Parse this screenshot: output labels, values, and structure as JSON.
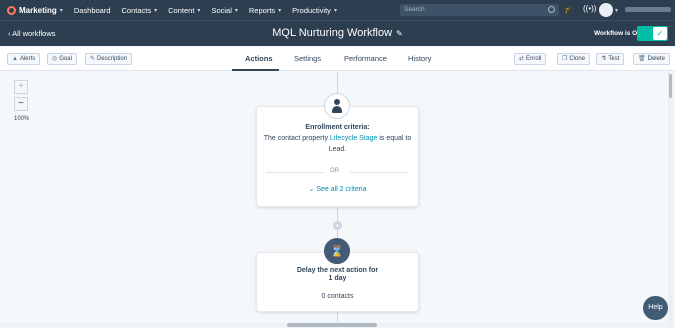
{
  "colors": {
    "nav_bg": "#2d3e50",
    "accent": "#ff7a59",
    "teal": "#00bda5",
    "link": "#0091ae"
  },
  "topnav": {
    "brand": "Marketing",
    "items": [
      "Dashboard",
      "Contacts",
      "Content",
      "Social",
      "Reports",
      "Productivity"
    ],
    "search_placeholder": "Search"
  },
  "header": {
    "back_label": "All workflows",
    "title": "MQL Nurturing Workflow",
    "status_label": "Workflow is ON",
    "toggle_check": "✓"
  },
  "toolbar": {
    "left_buttons": [
      {
        "label": "Alerts",
        "icon": "alert-icon"
      },
      {
        "label": "Goal",
        "icon": "goal-icon"
      },
      {
        "label": "Description",
        "icon": "description-icon"
      }
    ],
    "tabs": [
      "Actions",
      "Settings",
      "Performance",
      "History"
    ],
    "active_tab": "Actions",
    "right_buttons": [
      {
        "label": "Enroll",
        "icon": "enroll-icon"
      },
      {
        "label": "Clone",
        "icon": "clone-icon"
      },
      {
        "label": "Test",
        "icon": "test-icon"
      },
      {
        "label": "Delete",
        "icon": "trash-icon"
      }
    ]
  },
  "zoom": {
    "plus": "+",
    "minus": "−",
    "level": "100%"
  },
  "enrollment": {
    "title": "Enrollment criteria:",
    "text_before": "The contact property ",
    "link": "Lifecycle Stage",
    "text_after": " is equal to",
    "value": "Lead.",
    "or": "OR",
    "see_all": "See all 2 criteria"
  },
  "delay": {
    "title_line1": "Delay the next action for",
    "title_line2": "1 day",
    "contacts": "0 contacts"
  },
  "help_label": "Help"
}
